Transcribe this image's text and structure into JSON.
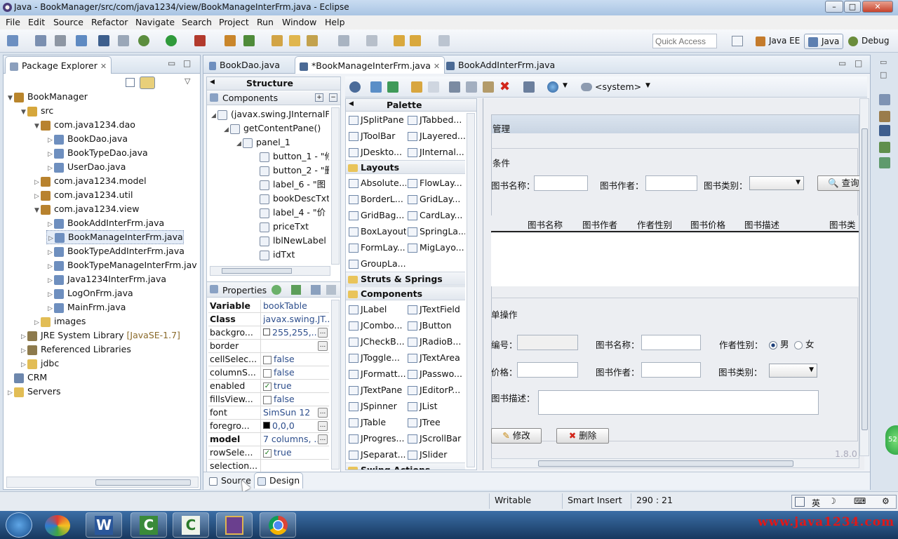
{
  "window": {
    "title": "Java - BookManager/src/com/java1234/view/BookManageInterFrm.java - Eclipse",
    "min": "–",
    "max": "□",
    "close": "✕"
  },
  "menu": [
    "File",
    "Edit",
    "Source",
    "Refactor",
    "Navigate",
    "Search",
    "Project",
    "Run",
    "Window",
    "Help"
  ],
  "toolbar": {
    "quick_access_placeholder": "Quick Access",
    "perspectives": [
      "Java EE",
      "Java",
      "Debug"
    ]
  },
  "package_explorer": {
    "title": "Package Explorer",
    "items": [
      {
        "label": "BookManager",
        "level": 0,
        "expanded": "▼",
        "icon": "project-icon",
        "color": "#b9852c"
      },
      {
        "label": "src",
        "level": 1,
        "expanded": "▼",
        "icon": "source-folder-icon",
        "color": "#d6a73c"
      },
      {
        "label": "com.java1234.dao",
        "level": 2,
        "expanded": "▼",
        "icon": "package-icon",
        "color": "#b8822e"
      },
      {
        "label": "BookDao.java",
        "level": 3,
        "expanded": "▷",
        "icon": "java-file-icon",
        "color": "#6e8fbf"
      },
      {
        "label": "BookTypeDao.java",
        "level": 3,
        "expanded": "▷",
        "icon": "java-file-icon",
        "color": "#6e8fbf"
      },
      {
        "label": "UserDao.java",
        "level": 3,
        "expanded": "▷",
        "icon": "java-file-icon",
        "color": "#6e8fbf"
      },
      {
        "label": "com.java1234.model",
        "level": 2,
        "expanded": "▷",
        "icon": "package-icon",
        "color": "#b8822e"
      },
      {
        "label": "com.java1234.util",
        "level": 2,
        "expanded": "▷",
        "icon": "package-icon",
        "color": "#b8822e"
      },
      {
        "label": "com.java1234.view",
        "level": 2,
        "expanded": "▼",
        "icon": "package-icon",
        "color": "#b8822e"
      },
      {
        "label": "BookAddInterFrm.java",
        "level": 3,
        "expanded": "▷",
        "icon": "java-file-icon",
        "color": "#6e8fbf"
      },
      {
        "label": "BookManageInterFrm.java",
        "level": 3,
        "expanded": "▷",
        "icon": "java-file-icon",
        "color": "#6e8fbf",
        "selected": true
      },
      {
        "label": "BookTypeAddInterFrm.java",
        "level": 3,
        "expanded": "▷",
        "icon": "java-file-icon",
        "color": "#6e8fbf"
      },
      {
        "label": "BookTypeManageInterFrm.jav",
        "level": 3,
        "expanded": "▷",
        "icon": "java-file-icon",
        "color": "#6e8fbf"
      },
      {
        "label": "Java1234InterFrm.java",
        "level": 3,
        "expanded": "▷",
        "icon": "java-file-icon",
        "color": "#6e8fbf"
      },
      {
        "label": "LogOnFrm.java",
        "level": 3,
        "expanded": "▷",
        "icon": "java-file-icon",
        "color": "#6e8fbf"
      },
      {
        "label": "MainFrm.java",
        "level": 3,
        "expanded": "▷",
        "icon": "java-file-icon",
        "color": "#6e8fbf"
      },
      {
        "label": "images",
        "level": 2,
        "expanded": "▷",
        "icon": "folder-icon",
        "color": "#e2bd55"
      },
      {
        "label": "JRE System Library",
        "suffix": "[JavaSE-1.7]",
        "level": 1,
        "expanded": "▷",
        "icon": "library-icon",
        "color": "#8d7a4c"
      },
      {
        "label": "Referenced Libraries",
        "level": 1,
        "expanded": "▷",
        "icon": "library-icon",
        "color": "#8d7a4c"
      },
      {
        "label": "jdbc",
        "level": 1,
        "expanded": "▷",
        "icon": "folder-icon",
        "color": "#e2bd55"
      },
      {
        "label": "CRM",
        "level": 0,
        "expanded": "",
        "icon": "project-icon",
        "color": "#6d87ad"
      },
      {
        "label": "Servers",
        "level": 0,
        "expanded": "▷",
        "icon": "folder-icon",
        "color": "#e2bd55"
      }
    ]
  },
  "editor_tabs": [
    {
      "label": "BookDao.java",
      "selected": false
    },
    {
      "label": "*BookManageInterFrm.java",
      "selected": true
    },
    {
      "label": "BookAddInterFrm.java",
      "selected": false
    }
  ],
  "structure": {
    "title": "Structure",
    "components_title": "Components",
    "items": [
      {
        "label": "(javax.swing.JInternalFr",
        "indent": 0
      },
      {
        "label": "getContentPane()",
        "indent": 1
      },
      {
        "label": "panel_1",
        "indent": 2
      },
      {
        "label": "button_1 - \"修",
        "indent": 3
      },
      {
        "label": "button_2 - \"删",
        "indent": 3
      },
      {
        "label": "label_6 - \"图",
        "indent": 3
      },
      {
        "label": "bookDescTxt",
        "indent": 3
      },
      {
        "label": "label_4 - \"价",
        "indent": 3
      },
      {
        "label": "priceTxt",
        "indent": 3
      },
      {
        "label": "lblNewLabel",
        "indent": 3
      },
      {
        "label": "idTxt",
        "indent": 3
      }
    ]
  },
  "properties": {
    "title": "Properties",
    "rows": [
      {
        "key": "Variable",
        "value": "bookTable",
        "bold": true
      },
      {
        "key": "Class",
        "value": "javax.swing.JT...",
        "bold": true
      },
      {
        "key": "backgro...",
        "value": "255,255,...",
        "swatch": "#ffffff",
        "dots": true
      },
      {
        "key": "border",
        "value": "",
        "dots": true
      },
      {
        "key": "cellSelec...",
        "value": "false",
        "check": ""
      },
      {
        "key": "columnS...",
        "value": "false",
        "check": ""
      },
      {
        "key": "enabled",
        "value": "true",
        "check": "✓"
      },
      {
        "key": "fillsView...",
        "value": "false",
        "check": ""
      },
      {
        "key": "font",
        "value": "SimSun 12",
        "dots": true
      },
      {
        "key": "foregro...",
        "value": "0,0,0",
        "swatch": "#000000",
        "dots": true
      },
      {
        "key": "model",
        "value": "7 columns, ...",
        "bold": true,
        "dots": true
      },
      {
        "key": "rowSele...",
        "value": "true",
        "check": "✓"
      },
      {
        "key": "selection...",
        "value": ""
      }
    ]
  },
  "palette": {
    "title": "Palette",
    "sections": [
      {
        "name": "",
        "rows": [
          [
            "JSplitPane",
            "JTabbed..."
          ],
          [
            "JToolBar",
            "JLayered..."
          ],
          [
            "JDeskto...",
            "JInternal..."
          ]
        ]
      },
      {
        "name": "Layouts",
        "rows": [
          [
            "Absolute...",
            "FlowLay..."
          ],
          [
            "BorderL...",
            "GridLay..."
          ],
          [
            "GridBag...",
            "CardLay..."
          ],
          [
            "BoxLayout",
            "SpringLa..."
          ],
          [
            "FormLay...",
            "MigLayo..."
          ],
          [
            "GroupLa..."
          ]
        ]
      },
      {
        "name": "Struts & Springs",
        "rows": []
      },
      {
        "name": "Components",
        "rows": [
          [
            "JLabel",
            "JTextField"
          ],
          [
            "JCombo...",
            "JButton"
          ],
          [
            "JCheckB...",
            "JRadioB..."
          ],
          [
            "JToggle...",
            "JTextArea"
          ],
          [
            "JFormatt...",
            "JPasswo..."
          ],
          [
            "JTextPane",
            "JEditorP..."
          ],
          [
            "JSpinner",
            "JList"
          ],
          [
            "JTable",
            "JTree"
          ],
          [
            "JProgres...",
            "JScrollBar"
          ],
          [
            "JSeparat...",
            "JSlider"
          ]
        ]
      },
      {
        "name": "Swing Actions",
        "rows": []
      }
    ]
  },
  "design_toolbar": {
    "system": "<system>"
  },
  "form": {
    "title": "管理",
    "search_section": "查询条件",
    "search_section_visible": "条件",
    "labels": {
      "book_name": "图书名称：",
      "author": "图书作者：",
      "type": "图书类别："
    },
    "query_button": "查询",
    "table_headers": [
      "图书名称",
      "图书作者",
      "作者性别",
      "图书价格",
      "图书描述",
      "图书类别"
    ],
    "edit_section": "表单操作",
    "edit_section_visible": "单操作",
    "edit_labels": {
      "id": "编号：",
      "name": "图书名称：",
      "gender": "作者性别：",
      "price": "价格：",
      "author": "图书作者：",
      "type": "图书类别：",
      "desc": "图书描述："
    },
    "gender_options": [
      "男",
      "女"
    ],
    "modify_button": "修改",
    "delete_button": "删除",
    "version_hint": "1.8.0"
  },
  "bottom_tabs": [
    "Source",
    "Design"
  ],
  "status": {
    "writable": "Writable",
    "insert_mode": "Smart Insert",
    "position": "290 : 21"
  },
  "taskbar": {
    "apps": [
      "start-orb-icon",
      "paint-icon",
      "word-icon",
      "camtasia-recorder-icon",
      "camtasia-studio-icon",
      "swing-ide-icon",
      "chrome-icon"
    ]
  },
  "watermark": "www.java1234.com",
  "tray": {
    "ime": "英",
    "badge": "52"
  }
}
